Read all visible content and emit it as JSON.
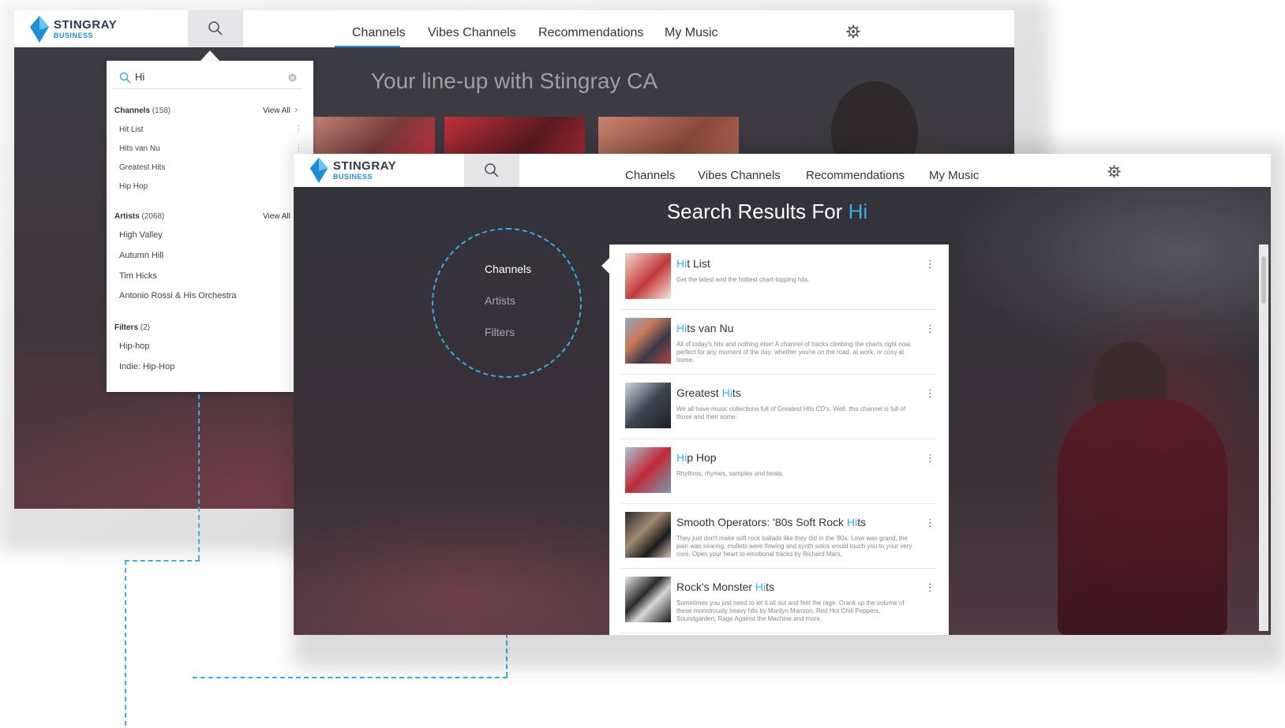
{
  "brand": {
    "name": "STINGRAY",
    "sub": "BUSINESS"
  },
  "nav": {
    "channels": "Channels",
    "vibes": "Vibes Channels",
    "recommendations": "Recommendations",
    "my_music": "My Music"
  },
  "background_page": {
    "title": "Your line-up with Stingray CA"
  },
  "dropdown": {
    "query": "Hi",
    "channels_label": "Channels",
    "channels_count": "(158)",
    "view_all": "View All",
    "channels": [
      "Hit List",
      "Hits van Nu",
      "Greatest Hits",
      "Hip Hop"
    ],
    "artists_label": "Artists",
    "artists_count": "(2068)",
    "artists": [
      "High Valley",
      "Autumn Hill",
      "Tim Hicks",
      "Antonio Rossi & His Orchestra"
    ],
    "filters_label": "Filters",
    "filters_count": "(2)",
    "filters": [
      "Hip-hop",
      "Indie: Hip-Hop"
    ]
  },
  "results": {
    "title_prefix": "Search Results For ",
    "query": "Hi",
    "categories": [
      "Channels",
      "Artists",
      "Filters"
    ],
    "items": [
      {
        "hl": "Hi",
        "rest": "t List",
        "pre": "",
        "desc": "Get the latest and the hottest chart-topping hits."
      },
      {
        "hl": "Hi",
        "rest": "ts van Nu",
        "pre": "",
        "desc": "All of today's hits and nothing else! A channel of tracks climbing the charts right now, perfect for any moment of the day: whether you're on the road, at work, or cosy at home."
      },
      {
        "pre": "Greatest ",
        "hl": "Hi",
        "rest": "ts",
        "desc": "We all have music collections full of Greatest Hits CD's. Well, this channel is full of those and then some."
      },
      {
        "hl": "Hi",
        "rest": "p Hop",
        "pre": "",
        "desc": "Rhythms, rhymes, samples and beats."
      },
      {
        "pre": "Smooth Operators: '80s Soft Rock ",
        "hl": "Hi",
        "rest": "ts",
        "desc": "They just don't make soft rock ballads like they did in the '80s. Love was grand, the pain was searing, mullets were flowing and synth solos would touch you to your very core. Open your heart to emotional tracks by Richard Marx,"
      },
      {
        "pre": "Rock's Monster ",
        "hl": "Hi",
        "rest": "ts",
        "desc": "Sometimes you just need to let it all out and feel the rage. Crank up the volume of these monstrously heavy hits by Marilyn Manson, Red Hot Chili Peppers, Soundgarden, Rage Against the Machine and more."
      }
    ]
  },
  "icons": {
    "search": "search-icon",
    "settings": "gear-icon",
    "clear": "clear-icon",
    "more": "more-vertical-icon",
    "chevron": "chevron-right-icon"
  },
  "colors": {
    "accent": "#1d8fd8",
    "highlight": "#3aaee8",
    "logo_dark": "#2d3a4a"
  }
}
